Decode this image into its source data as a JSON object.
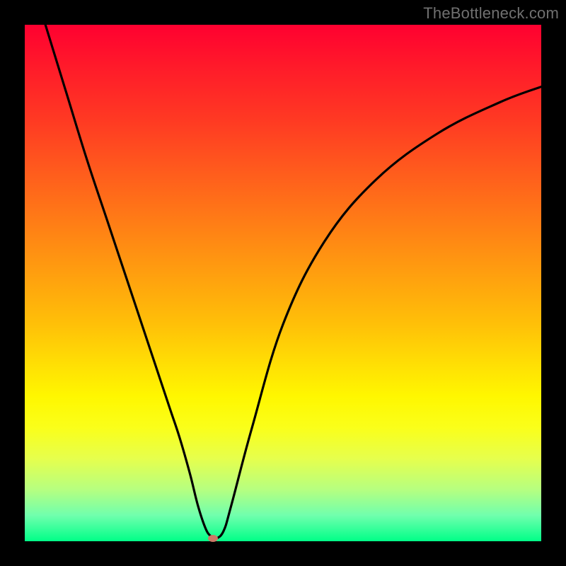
{
  "watermark": "TheBottleneck.com",
  "colors": {
    "frame": "#000000",
    "curve": "#000000",
    "marker": "#cc7766",
    "gradient_top": "#ff0030",
    "gradient_bottom": "#00ff88"
  },
  "chart_data": {
    "type": "line",
    "title": "",
    "xlabel": "",
    "ylabel": "",
    "xlim": [
      0,
      100
    ],
    "ylim": [
      0,
      100
    ],
    "grid": false,
    "annotations": [],
    "series": [
      {
        "name": "bottleneck-curve",
        "x": [
          4,
          8,
          12,
          16,
          20,
          24,
          28,
          30,
          32,
          33.5,
          35,
          36,
          37,
          38.5,
          40,
          44,
          50,
          58,
          68,
          80,
          92,
          100
        ],
        "values": [
          100,
          87,
          74,
          62,
          50,
          38,
          26,
          20,
          13,
          7,
          2.5,
          1,
          0.5,
          2,
          7,
          22,
          42,
          58,
          70,
          79,
          85,
          88
        ]
      }
    ],
    "marker": {
      "x": 36.5,
      "y": 0.5
    }
  }
}
